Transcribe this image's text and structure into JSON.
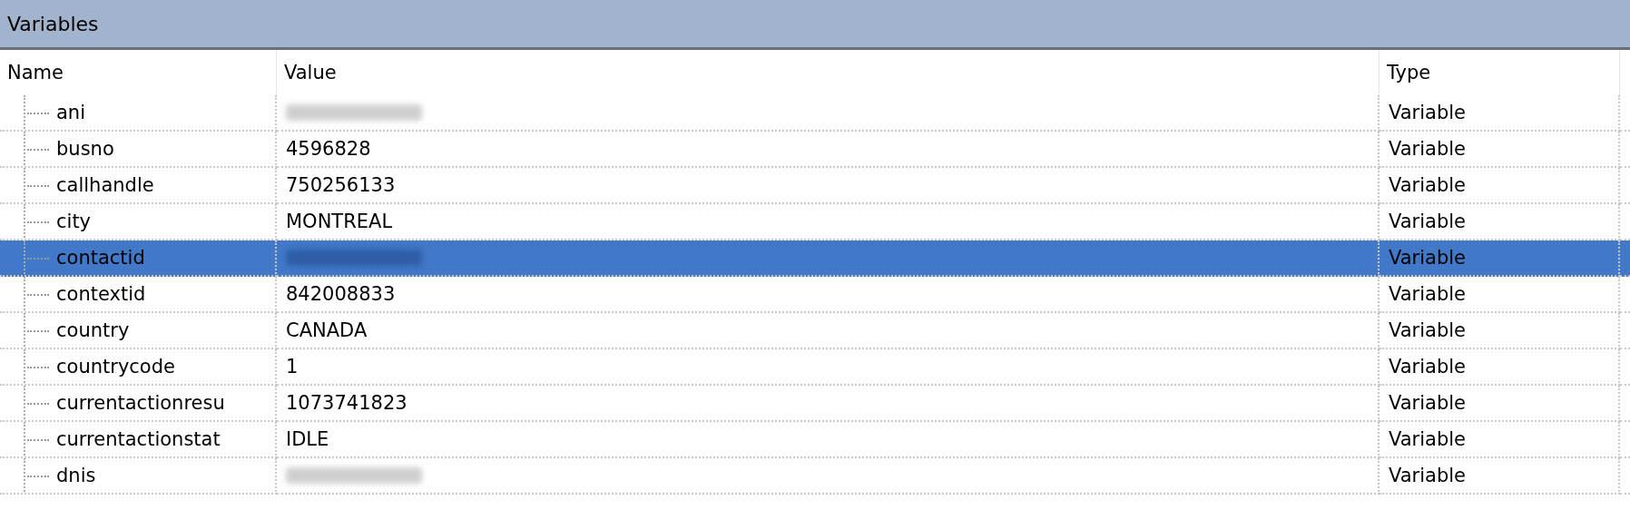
{
  "panel": {
    "title": "Variables"
  },
  "table": {
    "columns": [
      "Name",
      "Value",
      "Type"
    ],
    "rows": [
      {
        "name": "ani",
        "blurred": true,
        "type": "Variable",
        "selected": false
      },
      {
        "name": "busno",
        "value": "4596828",
        "blurred": false,
        "type": "Variable",
        "selected": false
      },
      {
        "name": "callhandle",
        "value": "750256133",
        "blurred": false,
        "type": "Variable",
        "selected": false
      },
      {
        "name": "city",
        "value": "MONTREAL",
        "blurred": false,
        "type": "Variable",
        "selected": false
      },
      {
        "name": "contactid",
        "blurred": true,
        "type": "Variable",
        "selected": true
      },
      {
        "name": "contextid",
        "value": "842008833",
        "blurred": false,
        "type": "Variable",
        "selected": false
      },
      {
        "name": "country",
        "value": "CANADA",
        "blurred": false,
        "type": "Variable",
        "selected": false
      },
      {
        "name": "countrycode",
        "value": "1",
        "blurred": false,
        "type": "Variable",
        "selected": false
      },
      {
        "name": "currentactionresu",
        "value": "1073741823",
        "blurred": false,
        "type": "Variable",
        "selected": false
      },
      {
        "name": "currentactionstat",
        "value": "IDLE",
        "blurred": false,
        "type": "Variable",
        "selected": false
      },
      {
        "name": "dnis",
        "blurred": true,
        "type": "Variable",
        "selected": false
      }
    ]
  }
}
